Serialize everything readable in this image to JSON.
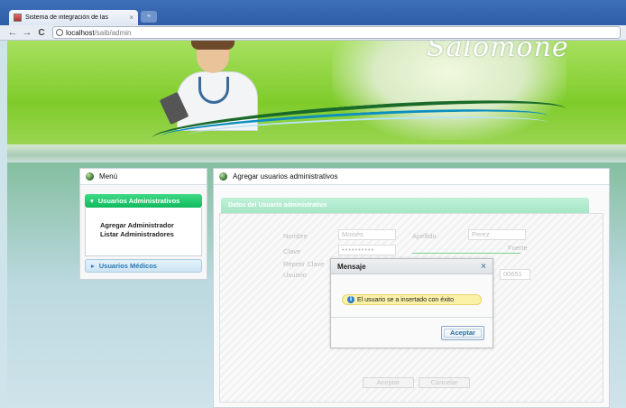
{
  "browser": {
    "tab_title": "Sistema de integración de las",
    "tab_close": "×",
    "newtab_label": "+",
    "back_glyph": "←",
    "forward_glyph": "→",
    "reload_glyph": "C",
    "url_host": "localhost",
    "url_path": "/saib/admin"
  },
  "header": {
    "logo_text": "Salomone"
  },
  "sidebar": {
    "title": "Menú",
    "sections": [
      {
        "label": "Usuarios Administrativos",
        "arrow": "▾",
        "items": [
          "Agregar Administrador",
          "Listar Administradores"
        ]
      },
      {
        "label": "Usuarios Médicos",
        "arrow": "▸"
      }
    ]
  },
  "main": {
    "title": "Agregar usuarios administrativos",
    "tab_header": "Datos del Usuario administrativo",
    "fields": {
      "nombre_label": "Nombre",
      "nombre_value": "Moisés",
      "apellido_label": "Apellido",
      "apellido_value": "Perez",
      "clave_label": "Clave",
      "clave_value": "••••••••••",
      "strength_label": "Fuerte",
      "repetir_label": "Repetir Clave",
      "usuario_label": "Usuario",
      "usuario_value_fragment": "00651"
    },
    "buttons": {
      "aceptar": "Aceptar",
      "cancelar": "Cancelar"
    }
  },
  "dialog": {
    "title": "Mensaje",
    "close_glyph": "×",
    "info_glyph": "i",
    "message": "El usuario se a insertado con éxito",
    "button": "Aceptar"
  }
}
